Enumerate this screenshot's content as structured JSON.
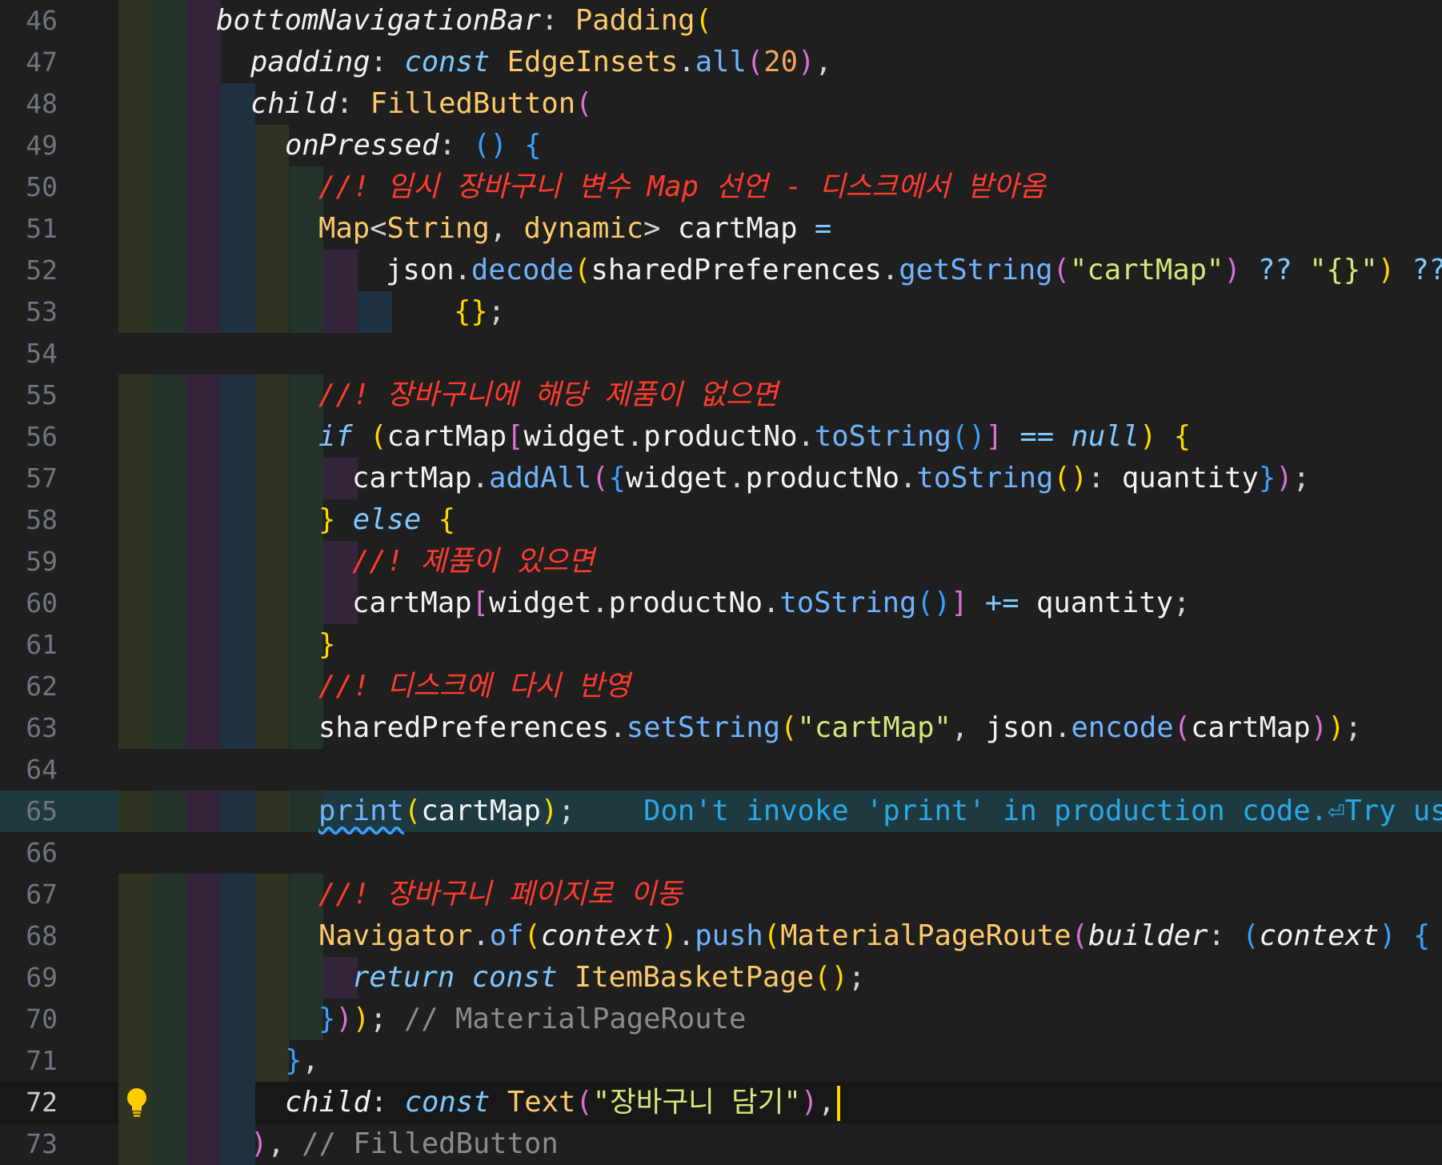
{
  "editor": {
    "lines": [
      {
        "n": "46",
        "tokens": [
          [
            "t-prop",
            "bottomNavigationBar"
          ],
          [
            "t-pun",
            ": "
          ],
          [
            "t-cls",
            "Padding"
          ],
          [
            "t-p1",
            "("
          ]
        ]
      },
      {
        "n": "47",
        "tokens": [
          [
            "t-prop",
            "padding"
          ],
          [
            "t-pun",
            ": "
          ],
          [
            "t-key",
            "const "
          ],
          [
            "t-cls",
            "EdgeInsets"
          ],
          [
            "t-pun",
            "."
          ],
          [
            "t-meth",
            "all"
          ],
          [
            "t-p2",
            "("
          ],
          [
            "t-num",
            "20"
          ],
          [
            "t-p2",
            ")"
          ],
          [
            "t-pun",
            ","
          ]
        ]
      },
      {
        "n": "48",
        "tokens": [
          [
            "t-prop",
            "child"
          ],
          [
            "t-pun",
            ": "
          ],
          [
            "t-cls",
            "FilledButton"
          ],
          [
            "t-p2",
            "("
          ]
        ]
      },
      {
        "n": "49",
        "tokens": [
          [
            "t-prop",
            "onPressed"
          ],
          [
            "t-pun",
            ": "
          ],
          [
            "t-p3",
            "()"
          ],
          [
            "t-pun",
            " "
          ],
          [
            "t-p3",
            "{"
          ]
        ]
      },
      {
        "n": "50",
        "tokens": [
          [
            "t-cmt",
            "//! 임시 장바구니 변수 Map 선언 - 디스크에서 받아옴"
          ]
        ]
      },
      {
        "n": "51",
        "tokens": [
          [
            "t-cls",
            "Map"
          ],
          [
            "t-pun",
            "<"
          ],
          [
            "t-cls",
            "String"
          ],
          [
            "t-pun",
            ", "
          ],
          [
            "t-cls",
            "dynamic"
          ],
          [
            "t-pun",
            "> "
          ],
          [
            "t-id",
            "cartMap"
          ],
          [
            "t-op",
            " ="
          ]
        ]
      },
      {
        "n": "52",
        "tokens": [
          [
            "t-id",
            "json"
          ],
          [
            "t-pun",
            "."
          ],
          [
            "t-meth",
            "decode"
          ],
          [
            "t-p1",
            "("
          ],
          [
            "t-id",
            "sharedPreferences"
          ],
          [
            "t-pun",
            "."
          ],
          [
            "t-meth",
            "getString"
          ],
          [
            "t-p2",
            "("
          ],
          [
            "t-str",
            "\"cartMap\""
          ],
          [
            "t-p2",
            ")"
          ],
          [
            "t-op",
            " ?? "
          ],
          [
            "t-str",
            "\"{}\""
          ],
          [
            "t-p1",
            ")"
          ],
          [
            "t-op",
            " ??"
          ]
        ]
      },
      {
        "n": "53",
        "tokens": [
          [
            "t-p1",
            "{}"
          ],
          [
            "t-pun",
            ";"
          ]
        ]
      },
      {
        "n": "54",
        "tokens": []
      },
      {
        "n": "55",
        "tokens": [
          [
            "t-cmt",
            "//! 장바구니에 해당 제품이 없으면"
          ]
        ]
      },
      {
        "n": "56",
        "tokens": [
          [
            "t-key",
            "if "
          ],
          [
            "t-p1",
            "("
          ],
          [
            "t-id",
            "cartMap"
          ],
          [
            "t-p2",
            "["
          ],
          [
            "t-id",
            "widget"
          ],
          [
            "t-pun",
            "."
          ],
          [
            "t-id",
            "productNo"
          ],
          [
            "t-pun",
            "."
          ],
          [
            "t-meth",
            "toString"
          ],
          [
            "t-p3",
            "()"
          ],
          [
            "t-p2",
            "]"
          ],
          [
            "t-op",
            " == "
          ],
          [
            "t-key",
            "null"
          ],
          [
            "t-p1",
            ")"
          ],
          [
            "t-pun",
            " "
          ],
          [
            "t-p1",
            "{"
          ]
        ]
      },
      {
        "n": "57",
        "tokens": [
          [
            "t-id",
            "cartMap"
          ],
          [
            "t-pun",
            "."
          ],
          [
            "t-meth",
            "addAll"
          ],
          [
            "t-p2",
            "("
          ],
          [
            "t-p3",
            "{"
          ],
          [
            "t-id",
            "widget"
          ],
          [
            "t-pun",
            "."
          ],
          [
            "t-id",
            "productNo"
          ],
          [
            "t-pun",
            "."
          ],
          [
            "t-meth",
            "toString"
          ],
          [
            "t-p1",
            "()"
          ],
          [
            "t-pun",
            ": "
          ],
          [
            "t-id",
            "quantity"
          ],
          [
            "t-p3",
            "}"
          ],
          [
            "t-p2",
            ")"
          ],
          [
            "t-pun",
            ";"
          ]
        ]
      },
      {
        "n": "58",
        "tokens": [
          [
            "t-p1",
            "}"
          ],
          [
            "t-pun",
            " "
          ],
          [
            "t-key",
            "else "
          ],
          [
            "t-p1",
            "{"
          ]
        ]
      },
      {
        "n": "59",
        "tokens": [
          [
            "t-cmt",
            "//! 제품이 있으면"
          ]
        ]
      },
      {
        "n": "60",
        "tokens": [
          [
            "t-id",
            "cartMap"
          ],
          [
            "t-p2",
            "["
          ],
          [
            "t-id",
            "widget"
          ],
          [
            "t-pun",
            "."
          ],
          [
            "t-id",
            "productNo"
          ],
          [
            "t-pun",
            "."
          ],
          [
            "t-meth",
            "toString"
          ],
          [
            "t-p3",
            "()"
          ],
          [
            "t-p2",
            "]"
          ],
          [
            "t-op",
            " += "
          ],
          [
            "t-id",
            "quantity"
          ],
          [
            "t-pun",
            ";"
          ]
        ]
      },
      {
        "n": "61",
        "tokens": [
          [
            "t-p1",
            "}"
          ]
        ]
      },
      {
        "n": "62",
        "tokens": [
          [
            "t-cmt",
            "//! 디스크에 다시 반영"
          ]
        ]
      },
      {
        "n": "63",
        "tokens": [
          [
            "t-id",
            "sharedPreferences"
          ],
          [
            "t-pun",
            "."
          ],
          [
            "t-meth",
            "setString"
          ],
          [
            "t-p1",
            "("
          ],
          [
            "t-str",
            "\"cartMap\""
          ],
          [
            "t-pun",
            ", "
          ],
          [
            "t-id",
            "json"
          ],
          [
            "t-pun",
            "."
          ],
          [
            "t-meth",
            "encode"
          ],
          [
            "t-p2",
            "("
          ],
          [
            "t-id",
            "cartMap"
          ],
          [
            "t-p2",
            ")"
          ],
          [
            "t-p1",
            ")"
          ],
          [
            "t-pun",
            ";"
          ]
        ]
      },
      {
        "n": "64",
        "tokens": []
      },
      {
        "n": "65",
        "tokens": [
          [
            "t-meth squig",
            "print"
          ],
          [
            "t-p1",
            "("
          ],
          [
            "t-id",
            "cartMap"
          ],
          [
            "t-p1",
            ")"
          ],
          [
            "t-pun",
            ";"
          ]
        ]
      },
      {
        "n": "66",
        "tokens": []
      },
      {
        "n": "67",
        "tokens": [
          [
            "t-cmt",
            "//! 장바구니 페이지로 이동"
          ]
        ]
      },
      {
        "n": "68",
        "tokens": [
          [
            "t-cls",
            "Navigator"
          ],
          [
            "t-pun",
            "."
          ],
          [
            "t-meth",
            "of"
          ],
          [
            "t-p1",
            "("
          ],
          [
            "t-ital",
            "context"
          ],
          [
            "t-p1",
            ")"
          ],
          [
            "t-pun",
            "."
          ],
          [
            "t-meth",
            "push"
          ],
          [
            "t-p1",
            "("
          ],
          [
            "t-cls",
            "MaterialPageRoute"
          ],
          [
            "t-p2",
            "("
          ],
          [
            "t-prop",
            "builder"
          ],
          [
            "t-pun",
            ": "
          ],
          [
            "t-p3",
            "("
          ],
          [
            "t-ital",
            "context"
          ],
          [
            "t-p3",
            ")"
          ],
          [
            "t-pun",
            " "
          ],
          [
            "t-p3",
            "{"
          ]
        ]
      },
      {
        "n": "69",
        "tokens": [
          [
            "t-key",
            "return "
          ],
          [
            "t-key",
            "const "
          ],
          [
            "t-cls",
            "ItemBasketPage"
          ],
          [
            "t-p1",
            "()"
          ],
          [
            "t-pun",
            ";"
          ]
        ]
      },
      {
        "n": "70",
        "tokens": [
          [
            "t-p3",
            "}"
          ],
          [
            "t-p2",
            ")"
          ],
          [
            "t-p1",
            ")"
          ],
          [
            "t-pun",
            "; "
          ],
          [
            "t-gray",
            "// MaterialPageRoute"
          ]
        ]
      },
      {
        "n": "71",
        "tokens": [
          [
            "t-p3",
            "}"
          ],
          [
            "t-pun",
            ","
          ]
        ]
      },
      {
        "n": "72",
        "tokens": [
          [
            "t-prop",
            "child"
          ],
          [
            "t-pun",
            ": "
          ],
          [
            "t-key",
            "const "
          ],
          [
            "t-cls",
            "Text"
          ],
          [
            "t-p2",
            "("
          ],
          [
            "t-str",
            "\"장바구니 담기\""
          ],
          [
            "t-p2",
            ")"
          ],
          [
            "t-pun",
            ","
          ]
        ]
      },
      {
        "n": "73",
        "tokens": [
          [
            "t-p2",
            ")"
          ],
          [
            "t-pun",
            ", "
          ],
          [
            "t-gray",
            "// FilledButton"
          ]
        ]
      }
    ],
    "inline_warning": "Don't invoke 'print' in production code.⏎Try usin",
    "active_line": "72",
    "lightbulb_icon": "lightbulb-icon"
  }
}
